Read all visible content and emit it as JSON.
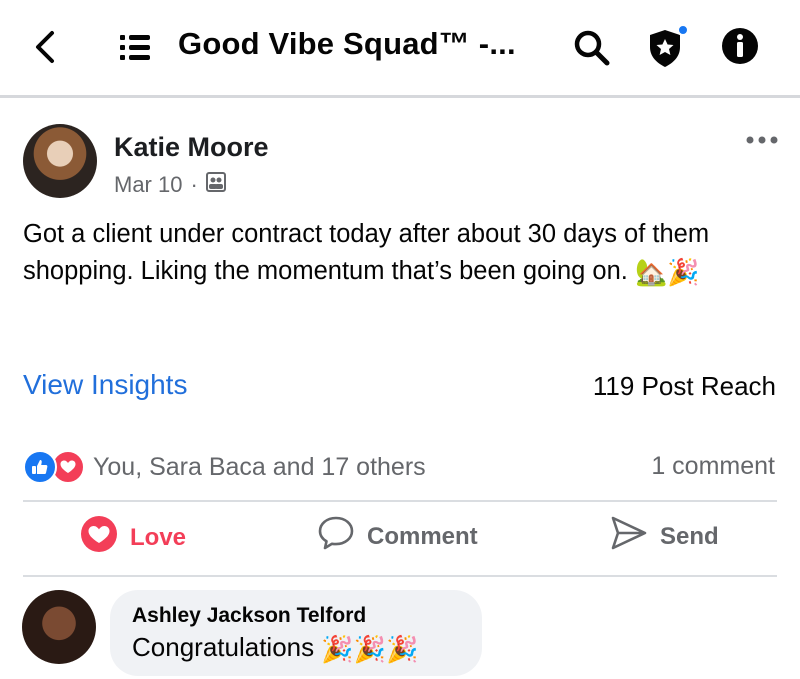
{
  "header": {
    "group_title": "Good Vibe Squad™ -...",
    "icons": [
      "back-arrow-icon",
      "menu-icon",
      "search-icon",
      "shield-star-icon",
      "info-icon"
    ],
    "notification_dot_color": "#1877f2"
  },
  "post": {
    "author": "Katie Moore",
    "date": "Mar 10",
    "separator": "·",
    "body": "Got a client under contract today after about 30 days of them shopping. Liking the momentum that’s been going on.",
    "emojis": [
      "🏡",
      "🎉"
    ],
    "view_insights": "View Insights",
    "post_reach": "119 Post Reach",
    "reactions_text": "You, Sara Baca and 17 others",
    "comment_count": "1 comment"
  },
  "actions": {
    "love": "Love",
    "comment": "Comment",
    "send": "Send"
  },
  "comment": {
    "author": "Ashley Jackson Telford",
    "text": "Congratulations",
    "emojis": "🎉🎉🎉"
  },
  "colors": {
    "link_blue": "#216fdb",
    "love_red": "#f33e58",
    "like_blue": "#1877f2",
    "muted_text": "#65676b"
  }
}
